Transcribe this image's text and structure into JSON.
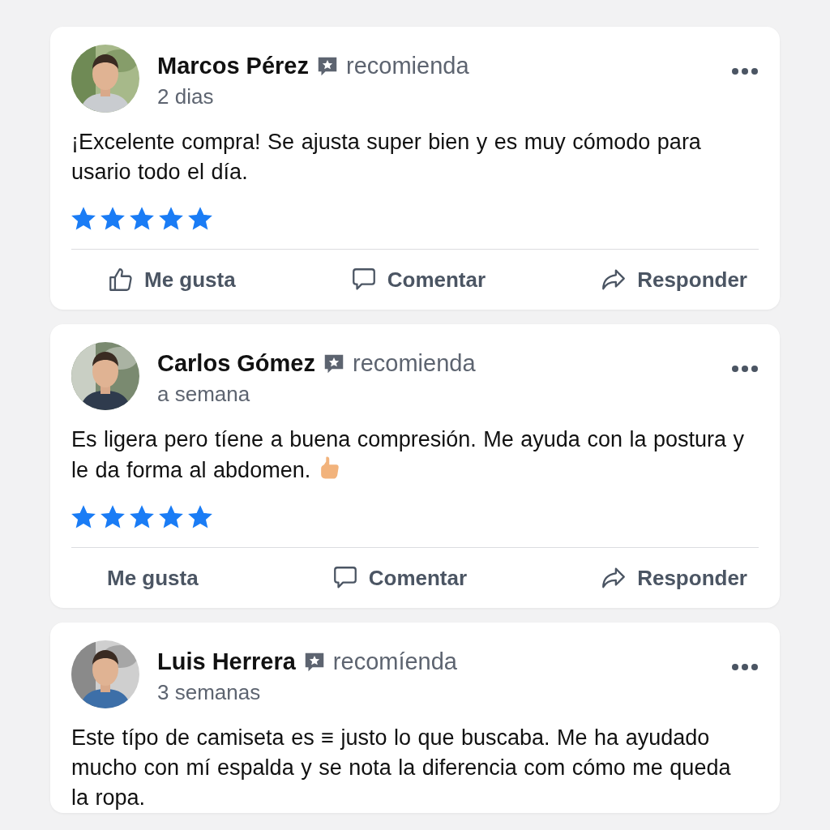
{
  "reviews": [
    {
      "name": "Marcos Pérez",
      "badge": "recomienda",
      "time": "2 dias",
      "text": "¡Excelente compra! Se ajusta super bien y es muy cómodo para usario todo el día.",
      "stars": 5,
      "actions": [
        {
          "label": "Me gusta",
          "kind": "like"
        },
        {
          "label": "Comentar",
          "kind": "comment"
        },
        {
          "label": "Responder",
          "kind": "reply"
        }
      ]
    },
    {
      "name": "Carlos Gómez",
      "badge": "recomienda",
      "time": "a semana",
      "text": "Es ligera pero tíene a buena compresión. Me ayuda con la postura y le da forma al abdomen.",
      "thumb_emoji": true,
      "stars": 5,
      "actions": [
        {
          "label": "Me gusta",
          "kind": "plain"
        },
        {
          "label": "Comentar",
          "kind": "comment"
        },
        {
          "label": "Responder",
          "kind": "reply"
        }
      ]
    },
    {
      "name": "Luis Herrera",
      "badge": "recomíenda",
      "time": "3 semanas",
      "text": "Este típo de camiseta es ≡ justo lo que buscaba. Me ha ayudado mucho con mí espalda y se nota la diferencia com cómo me queda la ropa."
    }
  ]
}
